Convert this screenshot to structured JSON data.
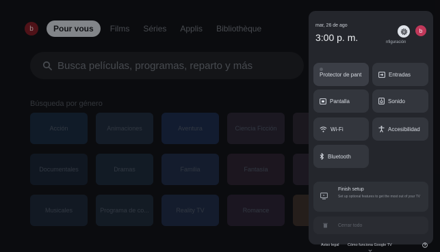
{
  "nav": {
    "avatar_letter": "b",
    "tabs": [
      "Pour vous",
      "Films",
      "Séries",
      "Applis",
      "Bibliothèque"
    ]
  },
  "search": {
    "placeholder": "Busca películas, programas, reparto y más"
  },
  "genres": {
    "title": "Búsqueda por género",
    "items": [
      {
        "label": "Acción",
        "color": "#1a2a3e"
      },
      {
        "label": "Animaciones",
        "color": "#1f2c3d"
      },
      {
        "label": "Aventura",
        "color": "#1c2c4a"
      },
      {
        "label": "Ciencia Ficción",
        "color": "#2a2534"
      },
      {
        "label": "",
        "color": "#2a2530"
      },
      {
        "label": "Documentales",
        "color": "#1a2433"
      },
      {
        "label": "Dramas",
        "color": "#1d2a3a"
      },
      {
        "label": "Familia",
        "color": "#1f2c46"
      },
      {
        "label": "Fantasía",
        "color": "#2b2331"
      },
      {
        "label": "",
        "color": "#2b2633"
      },
      {
        "label": "Musicales",
        "color": "#1c2736"
      },
      {
        "label": "Programa de co...",
        "color": "#1e2a38"
      },
      {
        "label": "Reality TV",
        "color": "#1f2b45"
      },
      {
        "label": "Romance",
        "color": "#2a2333"
      },
      {
        "label": "",
        "color": "#3a2e2a"
      }
    ]
  },
  "panel": {
    "date": "mar, 26 de ago",
    "time": "3:00 p. m.",
    "settings_label": "nfiguración",
    "profile_letter": "b",
    "tiles": {
      "screensaver": "Protector de pant",
      "inputs": "Entradas",
      "display": "Pantalla",
      "sound": "Sonido",
      "wifi": "Wi-Fi",
      "accessibility": "Accesibilidad",
      "bluetooth": "Bluetooth"
    },
    "setup": {
      "title": "Finish setup",
      "desc": "Set up optional features to get the most out of your TV"
    },
    "close_all": "Cerrar todo",
    "footer": {
      "legal": "Aviso legal",
      "how": "Cómo funciona Google TV"
    }
  },
  "colors": {
    "background": "#121317",
    "panel": "#24262c",
    "tile": "#33363d",
    "accent_profile": "#c0385a",
    "avatar": "#7a1c25"
  }
}
